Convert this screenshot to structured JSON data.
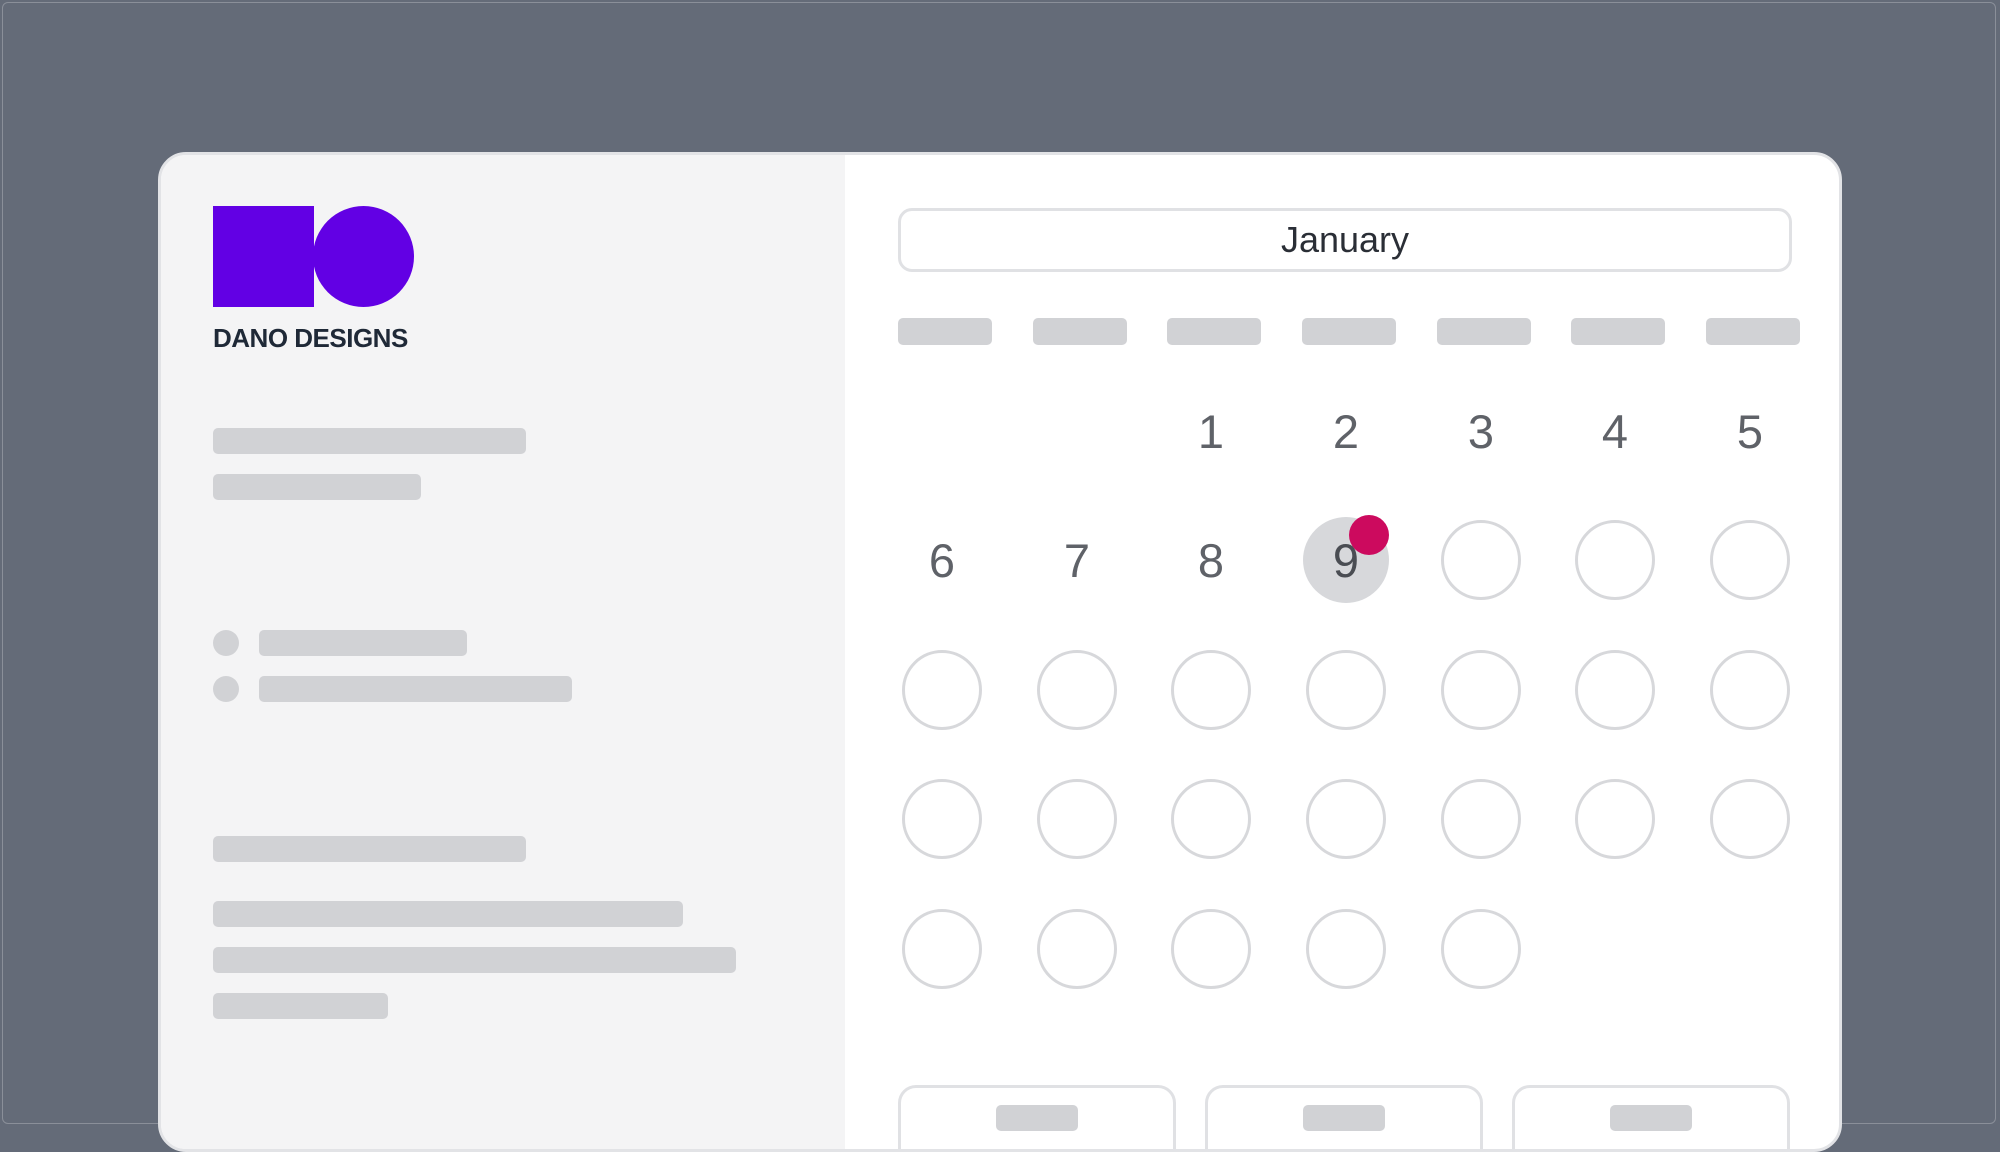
{
  "brand": {
    "name": "DANO DESIGNS",
    "color": "#6200e4"
  },
  "calendar": {
    "month": "January",
    "weekday_count": 7,
    "leading_blank_days": 2,
    "numbered_days": [
      "1",
      "2",
      "3",
      "4",
      "5",
      "6",
      "7",
      "8",
      "9"
    ],
    "selected_day": "9",
    "total_days": 31,
    "event_indicator_color": "#cc0a5e"
  },
  "colors": {
    "page_background": "#646b78",
    "left_panel": "#f4f4f5",
    "placeholder": "#d1d2d5"
  }
}
